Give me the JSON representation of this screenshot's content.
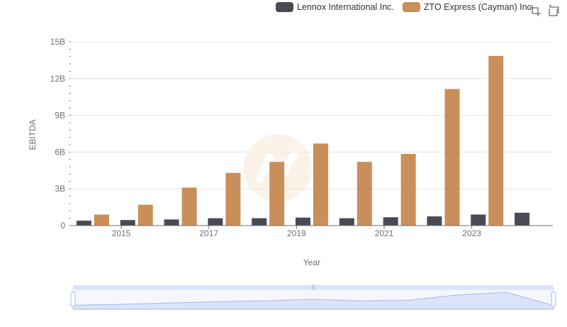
{
  "colors": {
    "lennox": "#4a4a55",
    "zto": "#c98f5a",
    "grid": "#e6e6e6",
    "axis": "#6e7079",
    "slider_fill": "#dbe4fb",
    "slider_border": "#a9b8e3",
    "slider_handle_bar": "#c5d2f4"
  },
  "legend": {
    "items": [
      {
        "label": "Lennox International Inc.",
        "color": "#4a4a55"
      },
      {
        "label": "ZTO Express (Cayman) Inc.",
        "color": "#c98f5a"
      }
    ]
  },
  "toolbox": {
    "icons": [
      "zoom-icon",
      "restore-icon"
    ]
  },
  "chart_data": {
    "type": "bar",
    "categories": [
      "2014",
      "2015",
      "2016",
      "2017",
      "2018",
      "2019",
      "2020",
      "2021",
      "2022",
      "2023",
      "2024"
    ],
    "tick_labels": [
      "2015",
      "2017",
      "2019",
      "2021",
      "2023"
    ],
    "y_ticks": [
      "0",
      "3B",
      "6B",
      "9B",
      "12B",
      "15B"
    ],
    "xlabel": "Year",
    "ylabel": "EBITDA",
    "ylim": [
      0,
      15000000000
    ],
    "grid": true,
    "legend_position": "top-right",
    "series": [
      {
        "name": "Lennox International Inc.",
        "values": [
          400000000,
          450000000,
          500000000,
          600000000,
          600000000,
          650000000,
          600000000,
          680000000,
          750000000,
          900000000,
          1050000000
        ]
      },
      {
        "name": "ZTO Express (Cayman) Inc.",
        "values": [
          900000000,
          1700000000,
          3100000000,
          4300000000,
          5200000000,
          6700000000,
          5200000000,
          5850000000,
          11150000000,
          13850000000,
          null
        ]
      }
    ]
  }
}
